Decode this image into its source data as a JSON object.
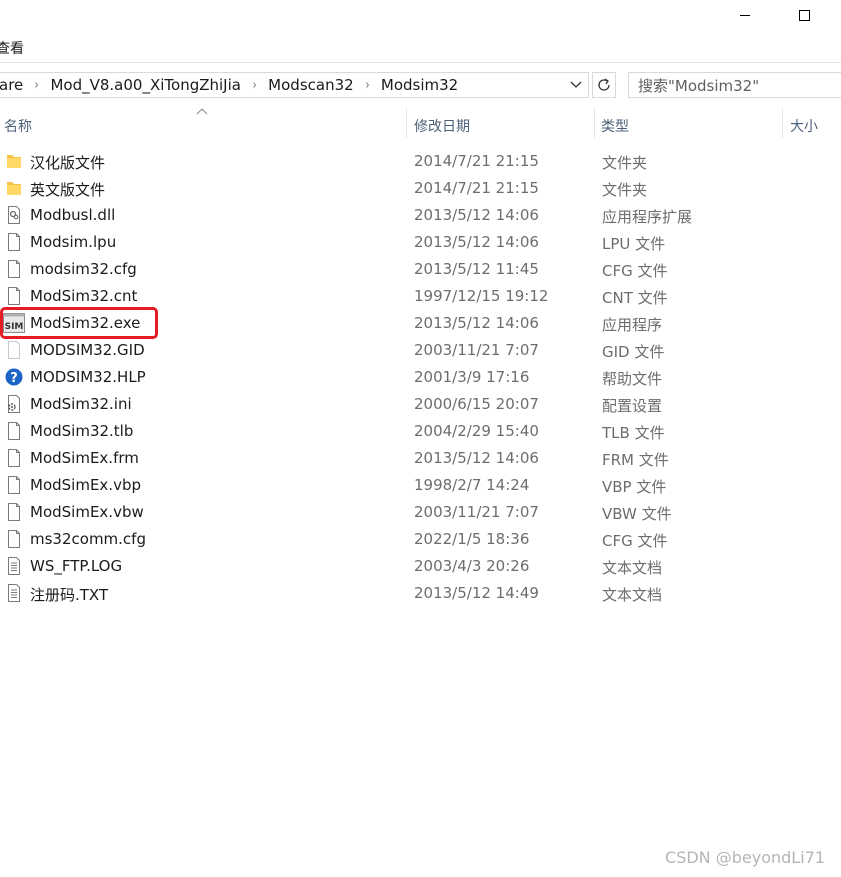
{
  "ribbon": {
    "view_tab": "查看"
  },
  "address": {
    "crumbs": [
      "are",
      "Mod_V8.a00_XiTongZhiJia",
      "Modscan32",
      "Modsim32"
    ],
    "separator": "›"
  },
  "search": {
    "placeholder": "搜索\"Modsim32\""
  },
  "columns": {
    "name": "名称",
    "date": "修改日期",
    "type": "类型",
    "size": "大小"
  },
  "files": [
    {
      "name": "汉化版文件",
      "date": "2014/7/21 21:15",
      "type": "文件夹",
      "icon": "folder-icon"
    },
    {
      "name": "英文版文件",
      "date": "2014/7/21 21:15",
      "type": "文件夹",
      "icon": "folder-icon"
    },
    {
      "name": "Modbusl.dll",
      "date": "2013/5/12 14:06",
      "type": "应用程序扩展",
      "icon": "dll-file-icon"
    },
    {
      "name": "Modsim.lpu",
      "date": "2013/5/12 14:06",
      "type": "LPU 文件",
      "icon": "file-icon"
    },
    {
      "name": "modsim32.cfg",
      "date": "2013/5/12 11:45",
      "type": "CFG 文件",
      "icon": "file-icon"
    },
    {
      "name": "ModSim32.cnt",
      "date": "1997/12/15 19:12",
      "type": "CNT 文件",
      "icon": "file-icon"
    },
    {
      "name": "ModSim32.exe",
      "date": "2013/5/12 14:06",
      "type": "应用程序",
      "icon": "exe-app-icon"
    },
    {
      "name": "MODSIM32.GID",
      "date": "2003/11/21 7:07",
      "type": "GID 文件",
      "icon": "blank-file-icon"
    },
    {
      "name": "MODSIM32.HLP",
      "date": "2001/3/9 17:16",
      "type": "帮助文件",
      "icon": "help-file-icon"
    },
    {
      "name": "ModSim32.ini",
      "date": "2000/6/15 20:07",
      "type": "配置设置",
      "icon": "ini-file-icon"
    },
    {
      "name": "ModSim32.tlb",
      "date": "2004/2/29 15:40",
      "type": "TLB 文件",
      "icon": "file-icon"
    },
    {
      "name": "ModSimEx.frm",
      "date": "2013/5/12 14:06",
      "type": "FRM 文件",
      "icon": "file-icon"
    },
    {
      "name": "ModSimEx.vbp",
      "date": "1998/2/7 14:24",
      "type": "VBP 文件",
      "icon": "file-icon"
    },
    {
      "name": "ModSimEx.vbw",
      "date": "2003/11/21 7:07",
      "type": "VBW 文件",
      "icon": "file-icon"
    },
    {
      "name": "ms32comm.cfg",
      "date": "2022/1/5 18:36",
      "type": "CFG 文件",
      "icon": "file-icon"
    },
    {
      "name": "WS_FTP.LOG",
      "date": "2003/4/3 20:26",
      "type": "文本文档",
      "icon": "text-file-icon"
    },
    {
      "name": "注册码.TXT",
      "date": "2013/5/12 14:49",
      "type": "文本文档",
      "icon": "text-file-icon"
    }
  ],
  "watermark": "CSDN @beyondLi71",
  "colors": {
    "highlight": "#e51c23",
    "folder": "#f3c245",
    "help": "#1b64c8"
  }
}
